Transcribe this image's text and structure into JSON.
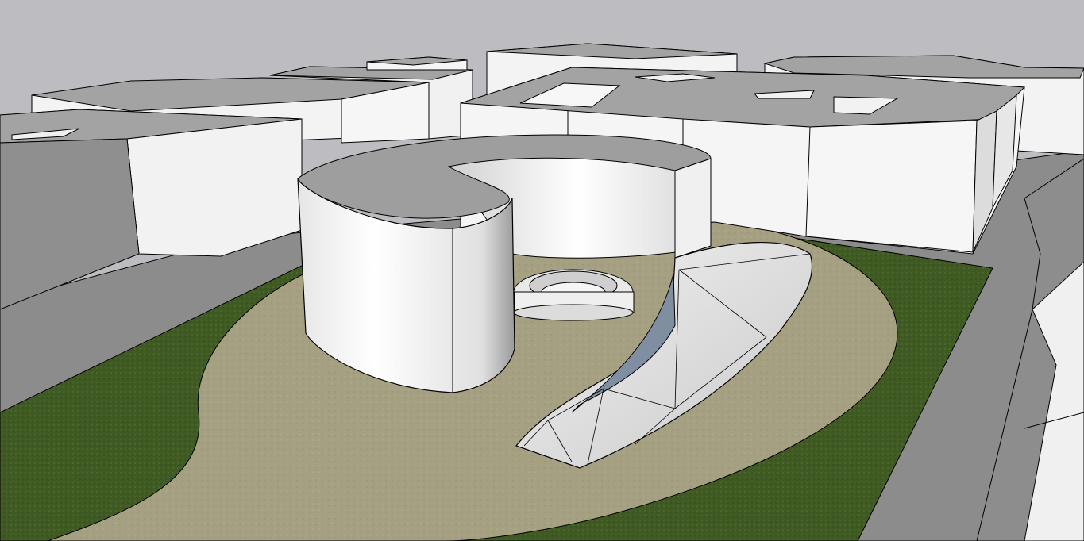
{
  "viewport": {
    "colors": {
      "sky": "#bdbdc1",
      "grass": "#3f5a22",
      "path": "#a6a082",
      "building_light": "#f2f2f2",
      "building_mid": "#d9d9d9",
      "building_dark": "#8f8f8f",
      "roof": "#a3a3a3",
      "road": "#8c8c8c",
      "spiral_wall": "#e8e8e8",
      "edge": "#000000"
    },
    "icons": [
      "none"
    ]
  }
}
